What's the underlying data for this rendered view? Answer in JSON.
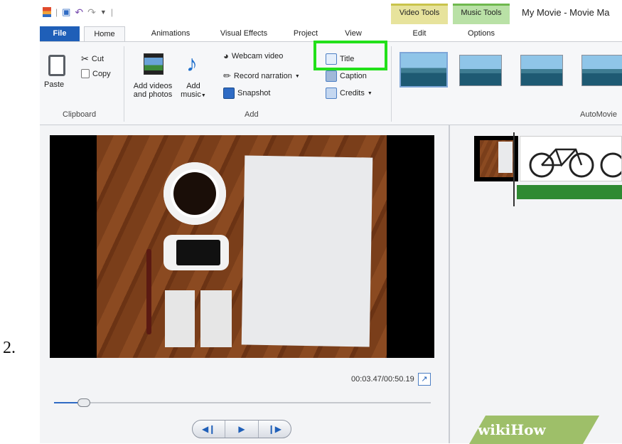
{
  "step_number": "2.",
  "window": {
    "title": "My Movie - Movie Ma",
    "context_tabs": [
      {
        "label": "Video Tools",
        "sub": "Edit"
      },
      {
        "label": "Music Tools",
        "sub": "Options"
      }
    ]
  },
  "tabs": [
    "File",
    "Home",
    "Animations",
    "Visual Effects",
    "Project",
    "View",
    "Edit",
    "Options"
  ],
  "ribbon": {
    "clipboard": {
      "group_label": "Clipboard",
      "paste": "Paste",
      "cut": "Cut",
      "copy": "Copy"
    },
    "add": {
      "group_label": "Add",
      "add_videos": [
        "Add videos",
        "and photos"
      ],
      "add_music": [
        "Add",
        "music"
      ],
      "webcam_video": "Webcam video",
      "record_narration": "Record narration",
      "snapshot": "Snapshot",
      "title": "Title",
      "caption": "Caption",
      "credits": "Credits"
    },
    "automovie": {
      "group_label": "AutoMovie"
    }
  },
  "preview": {
    "time": "00:03.47/00:50.19",
    "progress_fraction": 0.07
  },
  "watermark": "wikiHow"
}
